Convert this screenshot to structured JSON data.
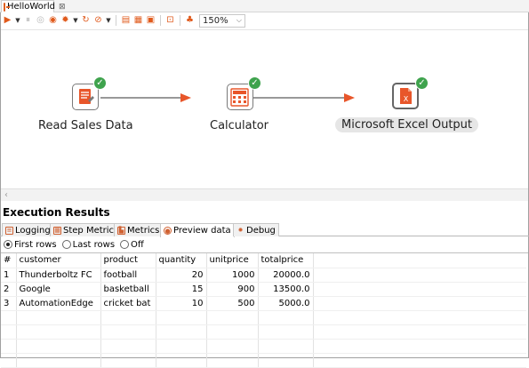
{
  "tab": {
    "title": "HelloWorld",
    "close": "⊠"
  },
  "toolbar": {
    "zoom": "150%"
  },
  "steps": [
    {
      "label": "Read Sales Data",
      "icon": "read-sales-data-icon",
      "status": "ok"
    },
    {
      "label": "Calculator",
      "icon": "calculator-icon",
      "status": "ok"
    },
    {
      "label": "Microsoft Excel Output",
      "icon": "excel-output-icon",
      "status": "ok"
    }
  ],
  "results": {
    "title": "Execution Results",
    "tabs": [
      "Logging",
      "Step Metrics",
      "Metrics",
      "Preview data",
      "Debug"
    ],
    "active_tab": "Preview data",
    "radios": [
      {
        "label": "First rows",
        "checked": true
      },
      {
        "label": "Last rows",
        "checked": false
      },
      {
        "label": "Off",
        "checked": false
      }
    ],
    "columns": [
      "#",
      "customer",
      "product",
      "quantity",
      "unitprice",
      "totalprice"
    ],
    "rows": [
      [
        "1",
        "Thunderboltz FC",
        "football",
        "20",
        "1000",
        "20000.0"
      ],
      [
        "2",
        "Google",
        "basketball",
        "15",
        "900",
        "13500.0"
      ],
      [
        "3",
        "AutomationEdge",
        "cricket bat",
        "10",
        "500",
        "5000.0"
      ]
    ]
  },
  "colors": {
    "accent": "#e8562a",
    "check": "#3fa34d"
  }
}
